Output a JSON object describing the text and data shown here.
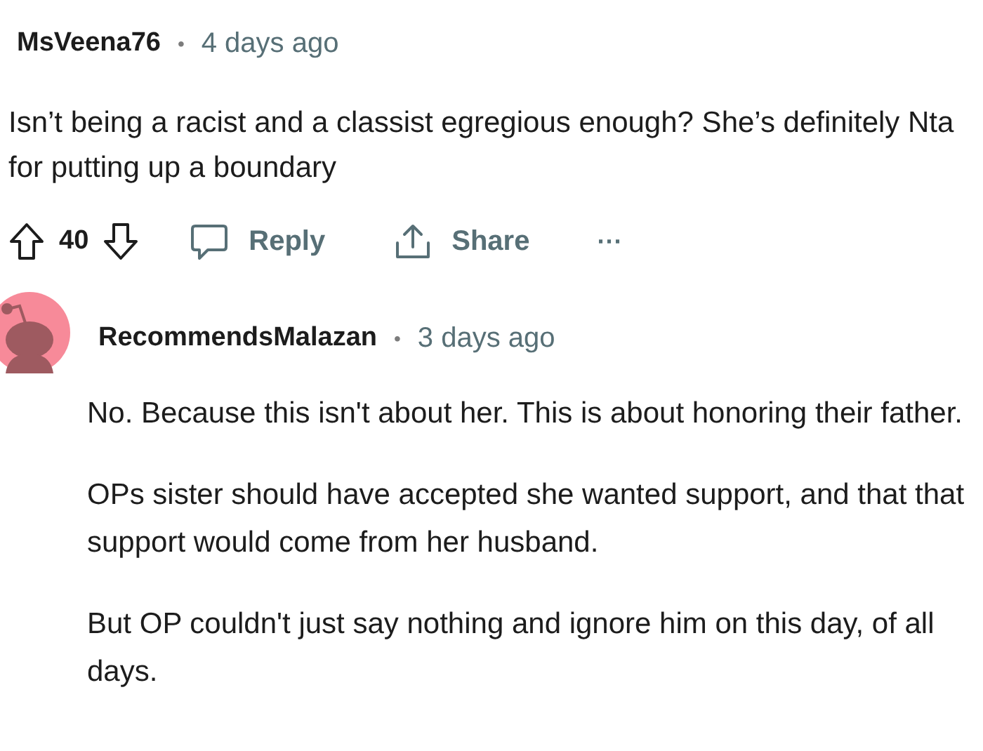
{
  "comment": {
    "author": "MsVeena76",
    "separator": "•",
    "time": "4 days ago",
    "body": [
      "Isn’t being a racist and a classist egregious enough? She’s definitely Nta for putting up a boundary"
    ],
    "actions": {
      "score": "40",
      "reply": "Reply",
      "share": "Share",
      "more": "···"
    }
  },
  "reply": {
    "author": "RecommendsMalazan",
    "separator": "•",
    "time": "3 days ago",
    "body": [
      "No. Because this isn't about her. This is about honoring their father.",
      "OPs sister should have accepted she wanted support, and that that support would come from her husband.",
      "But OP couldn't just say nothing and ignore him on this day, of all days."
    ]
  }
}
